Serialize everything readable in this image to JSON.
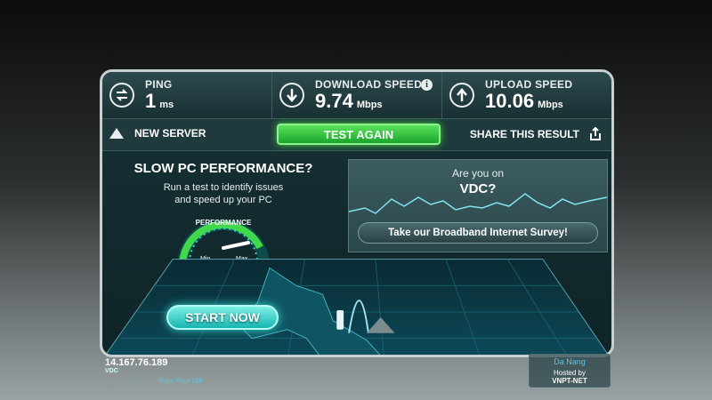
{
  "stats": {
    "ping": {
      "label": "PING",
      "value": "1",
      "unit": "ms"
    },
    "download": {
      "label": "DOWNLOAD SPEED",
      "value": "9.74",
      "unit": "Mbps"
    },
    "upload": {
      "label": "UPLOAD SPEED",
      "value": "10.06",
      "unit": "Mbps"
    }
  },
  "actions": {
    "new_server": "NEW SERVER",
    "test_again": "TEST AGAIN",
    "share": "SHARE THIS RESULT"
  },
  "ad_left": {
    "title": "SLOW PC PERFORMANCE?",
    "line1": "Run a test to identify issues",
    "line2": "and speed up your PC",
    "gauge_label": "PERFORMANCE",
    "gauge_min": "Min",
    "gauge_max": "Max",
    "gauge_level": 0.85,
    "start_button": "START NOW"
  },
  "ad_right": {
    "question": "Are you on",
    "isp": "VDC?",
    "survey_button": "Take our Broadband Internet Survey!"
  },
  "client": {
    "ip": "14.167.76.189",
    "isp": "VDC",
    "rating": 0,
    "rating_max": 5,
    "rate_label": "Rate Your ISP"
  },
  "server": {
    "city": "Da Nang",
    "hosted_label": "Hosted by",
    "host": "VNPT-NET"
  },
  "colors": {
    "accent_green": "#2fc43f",
    "accent_cyan": "#2fd6cf",
    "panel_bg": "#173236",
    "text_link": "#5ac8e0"
  },
  "icons": {
    "ping": "ping-icon",
    "download": "download-arrow-icon",
    "upload": "upload-arrow-icon",
    "info": "info-icon",
    "new_server": "triangle-icon",
    "share": "share-icon",
    "star": "star-icon"
  }
}
